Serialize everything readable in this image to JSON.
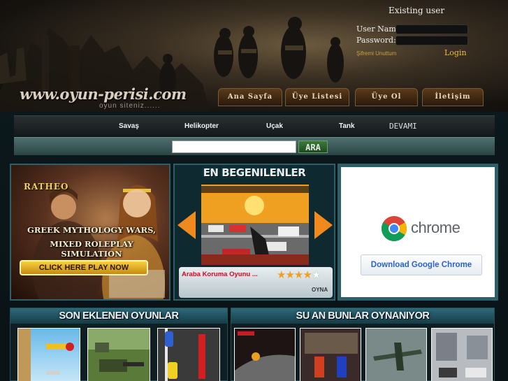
{
  "header": {
    "logo_text": "www.oyun-perisi.com",
    "logo_sub": "oyun siteniz......"
  },
  "login": {
    "title": "Existing user",
    "user_label": "User Name:",
    "password_label": "Password:",
    "forgot": "Şifremi Unuttum",
    "login_button": "Login"
  },
  "nav": {
    "items": [
      {
        "label": "Ana Sayfa"
      },
      {
        "label": "Üye Listesi"
      },
      {
        "label": "Üye Ol"
      },
      {
        "label": "İletişim"
      }
    ]
  },
  "categories": {
    "items": [
      "Savaş",
      "Helikopter",
      "Uçak",
      "Tank"
    ],
    "more": "DEVAMI"
  },
  "search": {
    "placeholder": "",
    "button": "ARA"
  },
  "ad": {
    "brand": "RATHEO",
    "line1": "GREEK MYTHOLOGY WARS,",
    "line2": "MIXED ROLEPLAY SIMULATION",
    "cta": "CLICK HERE PLAY NOW"
  },
  "featured": {
    "title": "EN BEGENILENLER",
    "game_title": "Araba Koruma Oyunu ...",
    "rating": 4,
    "rating_max": 5,
    "play": "OYNA"
  },
  "chrome_ad": {
    "brand": "chrome",
    "button": "Download Google Chrome"
  },
  "sections": {
    "latest": {
      "title": "SON EKLENEN OYUNLAR"
    },
    "now_playing": {
      "title": "SU AN BUNLAR OYNANIYOR"
    }
  },
  "colors": {
    "accent": "#f08a1e",
    "panel_border": "#2e5e66",
    "caption_red": "#c4101e"
  }
}
